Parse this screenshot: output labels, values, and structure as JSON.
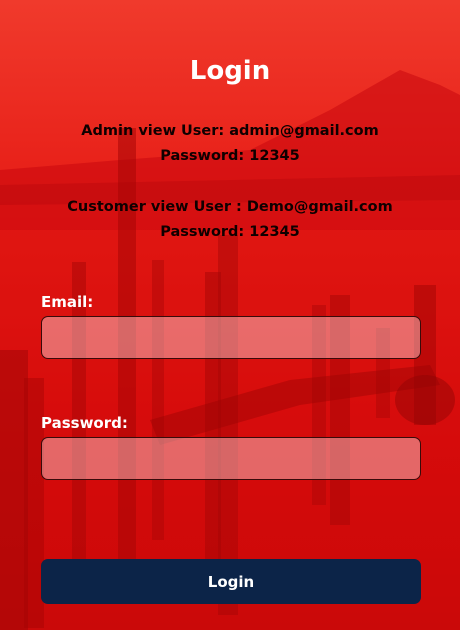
{
  "page": {
    "title": "Login"
  },
  "credentials": {
    "admin_user": "Admin view User: admin@gmail.com",
    "admin_password": "Password: 12345",
    "customer_user": "Customer view User : Demo@gmail.com",
    "customer_password": "Password: 12345"
  },
  "form": {
    "email_label": "Email:",
    "email_value": "",
    "password_label": "Password:",
    "password_value": "",
    "submit_label": "Login"
  },
  "theme": {
    "background_overlay": "#e61a14",
    "button_color": "#0c2448",
    "title_color": "#ffffff"
  }
}
